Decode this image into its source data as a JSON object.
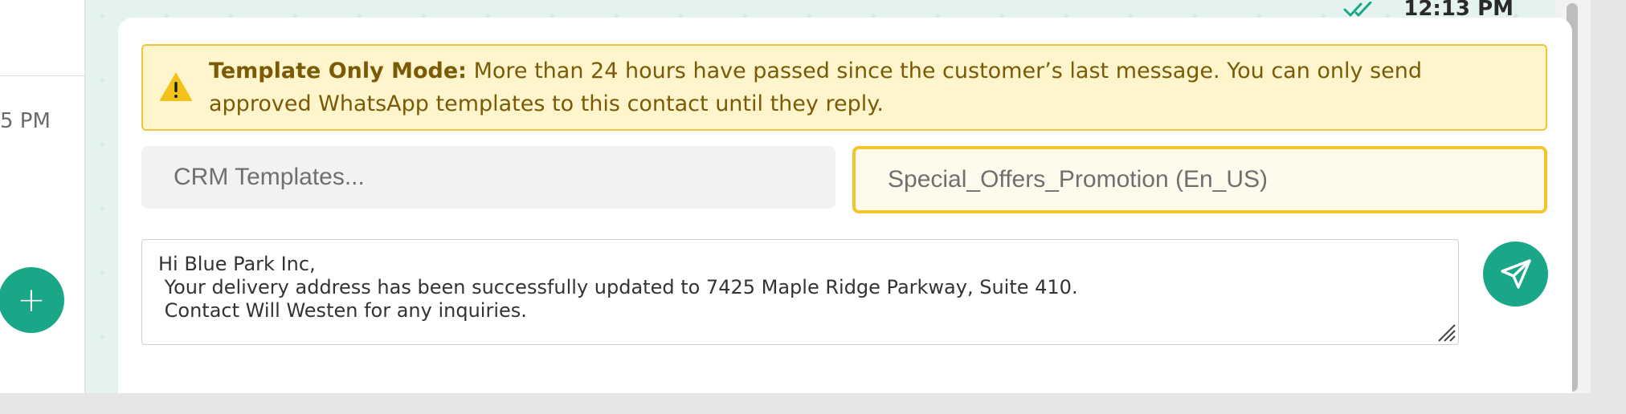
{
  "sidebar": {
    "time_fragment": "5 PM",
    "new_chat_icon": "plus"
  },
  "chat": {
    "last_message_time": "12:13 PM",
    "read_status_icon": "double-check-icon"
  },
  "alert": {
    "icon": "warning-triangle-icon",
    "title": "Template Only Mode:",
    "message": " More than 24 hours have passed since the customer’s last message. You can only send approved WhatsApp templates to this contact until they reply."
  },
  "composer": {
    "crm_templates_placeholder": "CRM Templates...",
    "selected_template": "Special_Offers_Promotion (En_US)",
    "message_lines": [
      "Hi Blue Park Inc,",
      " Your delivery address has been successfully updated to 7425 Maple Ridge Parkway, Suite 410.",
      " Contact Will Westen for any inquiries."
    ],
    "send_icon": "send-icon"
  },
  "colors": {
    "brand_green": "#1aa788",
    "alert_bg": "#fef5cc",
    "alert_border": "#f2c43a",
    "alert_text": "#7a5a05",
    "chat_bg": "#e4f3ef"
  }
}
